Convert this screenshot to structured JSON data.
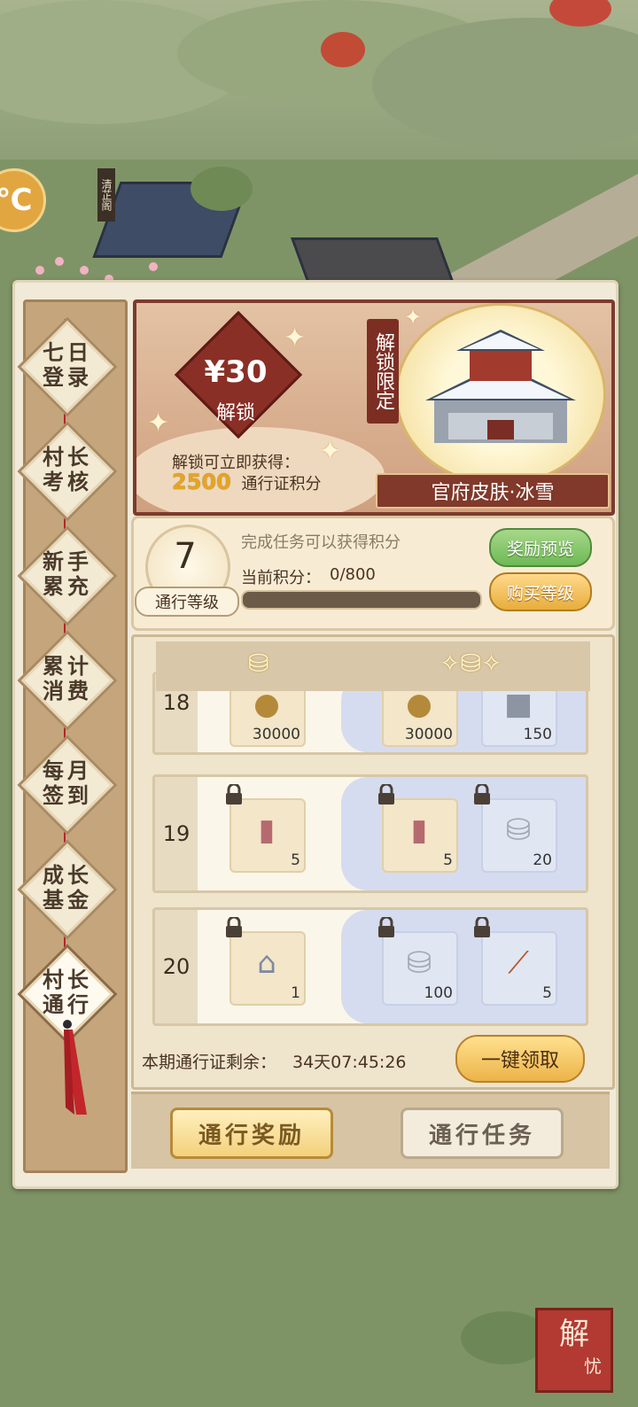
{
  "background": {
    "sign": "清芷阁",
    "stamp": [
      "解",
      "忧"
    ]
  },
  "sidebar": {
    "tabs": [
      {
        "label": [
          "七日",
          "登录"
        ]
      },
      {
        "label": [
          "村长",
          "考核"
        ]
      },
      {
        "label": [
          "新手",
          "累充"
        ]
      },
      {
        "label": [
          "累计",
          "消费"
        ]
      },
      {
        "label": [
          "每月",
          "签到"
        ]
      },
      {
        "label": [
          "成长",
          "基金"
        ]
      },
      {
        "label": [
          "村长",
          "通行"
        ]
      }
    ],
    "active_tab": "村长通行"
  },
  "banner": {
    "price": "¥30",
    "price_sub": "解锁",
    "unlock_text": "解锁可立即获得：",
    "unlock_points_value": "2500",
    "unlock_points_label": "通行证积分",
    "limited_tag": "解锁限定",
    "skin_name": "官府皮肤·冰雪"
  },
  "level": {
    "value": "7",
    "label": "通行等级",
    "task_hint": "完成任务可以获得积分",
    "current_points_label": "当前积分：",
    "current_points_value": "0/800",
    "progress_fraction": 0.0,
    "preview_button": "奖励预览",
    "buy_level_button": "购买等级"
  },
  "rewards": {
    "rows": [
      {
        "level": "18",
        "free": {
          "icon": "coin-icon",
          "qty": "30000"
        },
        "premium": [
          {
            "icon": "coin-icon",
            "qty": "30000"
          },
          {
            "icon": "stone-icon",
            "qty": "150"
          }
        ]
      },
      {
        "level": "19",
        "free": {
          "icon": "book-icon",
          "qty": "5"
        },
        "premium": [
          {
            "icon": "book-icon",
            "qty": "5"
          },
          {
            "icon": "silver-ingot-icon",
            "qty": "20"
          }
        ]
      },
      {
        "level": "20",
        "free": {
          "icon": "building-icon",
          "qty": "1"
        },
        "premium": [
          {
            "icon": "silver-ingot-icon",
            "qty": "100"
          },
          {
            "icon": "brush-icon",
            "qty": "5"
          }
        ]
      }
    ]
  },
  "footer": {
    "remaining_label": "本期通行证剩余：",
    "remaining_value": "34天07:45:26",
    "claim_all_button": "一键领取",
    "tab_reward": "通行奖励",
    "tab_task": "通行任务"
  },
  "colors": {
    "accent_red": "#7d2e23",
    "gold": "#e6a520",
    "green_btn": "#6fb955",
    "premium_bg": "#d6dcef"
  }
}
